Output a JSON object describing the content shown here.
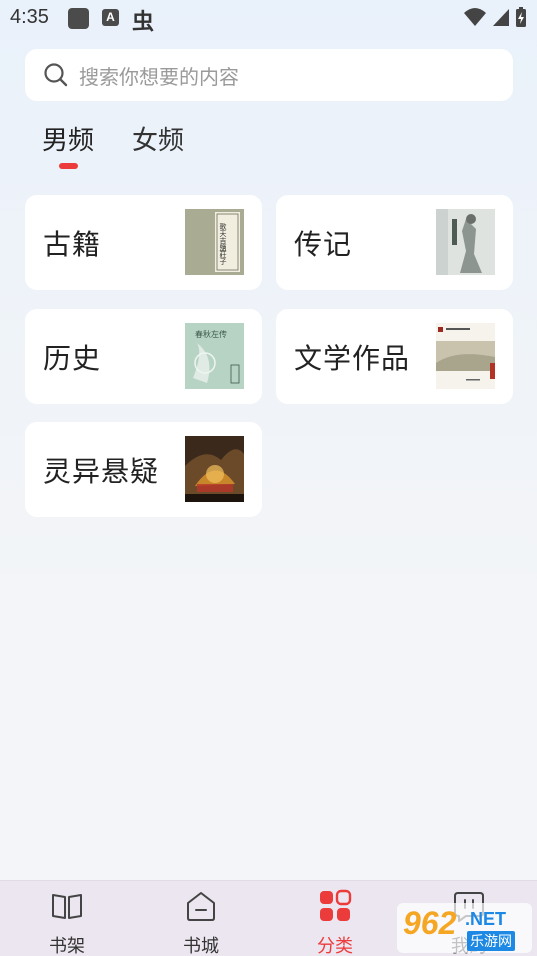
{
  "status_bar": {
    "time": "4:35",
    "a_glyph": "A",
    "bug_glyph": "虫"
  },
  "search": {
    "placeholder": "搜索你想要的内容"
  },
  "tabs": [
    {
      "label": "男频",
      "active": true
    },
    {
      "label": "女频",
      "active": false
    }
  ],
  "categories": [
    {
      "label": "古籍",
      "cover_text": "歌天吉鹽莊子"
    },
    {
      "label": "传记",
      "cover_text": ""
    },
    {
      "label": "历史",
      "cover_text": "春秋左传"
    },
    {
      "label": "文学作品",
      "cover_text": ""
    },
    {
      "label": "灵异悬疑",
      "cover_text": ""
    }
  ],
  "bottom_nav": [
    {
      "label": "书架",
      "icon": "book-open-icon",
      "active": false
    },
    {
      "label": "书城",
      "icon": "home-icon",
      "active": false
    },
    {
      "label": "分类",
      "icon": "category-grid-icon",
      "active": true
    },
    {
      "label": "我的",
      "icon": "profile-icon",
      "active": false
    }
  ],
  "watermark": {
    "number": "962",
    "net": ".NET",
    "sub": "乐游网"
  },
  "colors": {
    "accent": "#ec3b3b",
    "card_bg": "#ffffff",
    "nav_bg": "#ece6f0"
  }
}
